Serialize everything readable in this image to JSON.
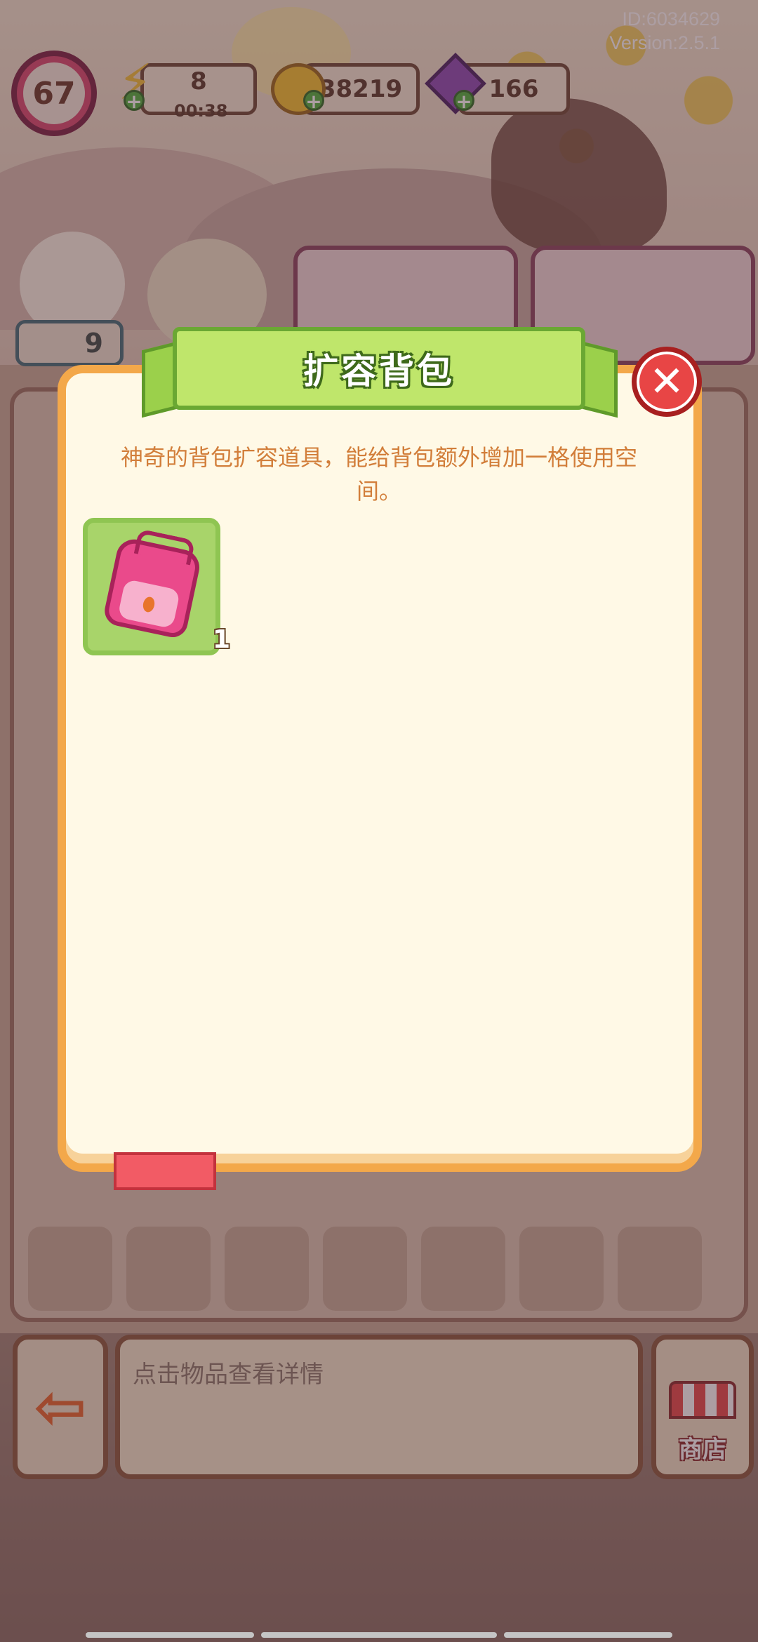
{
  "hud": {
    "user_id": "ID:6034629",
    "version": "Version:2.5.1",
    "level": "67",
    "energy": "8",
    "energy_timer": "00:38",
    "coins": "38219",
    "gems": "166"
  },
  "quests": {
    "duck_badge": "9"
  },
  "dialog": {
    "title": "扩容背包",
    "description": "神奇的背包扩容道具，能给背包额外增加一格使用空间。",
    "items": [
      {
        "icon": "backpack-icon",
        "count": "1"
      }
    ]
  },
  "bottom_bar": {
    "info_placeholder": "点击物品查看详情",
    "shop_label": "商店"
  },
  "colors": {
    "dialog_border": "#f3a84a",
    "ribbon_green": "#bfe66b",
    "close_red": "#e84545",
    "description_text": "#d27e3a"
  }
}
